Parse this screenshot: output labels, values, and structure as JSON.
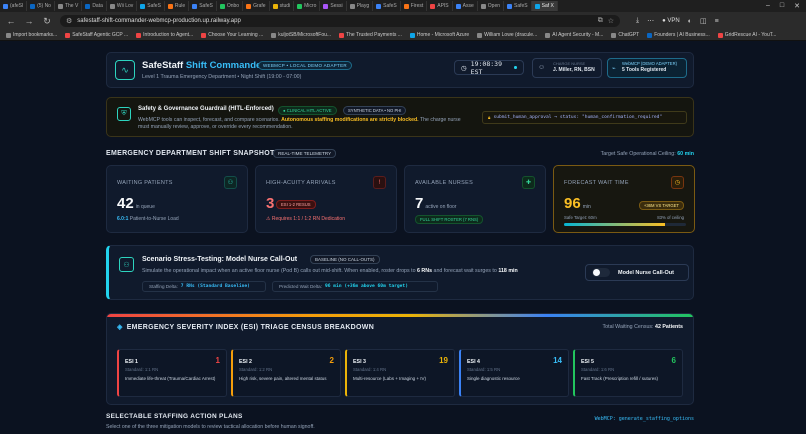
{
  "browser": {
    "tabs": [
      {
        "label": "(afeSl",
        "color": "#3b82f6"
      },
      {
        "label": "(5) No",
        "color": "#0a66c2"
      },
      {
        "label": "The V",
        "color": "#888888"
      },
      {
        "label": "Data",
        "color": "#0a66c2"
      },
      {
        "label": "Wii Lov",
        "color": "#888888"
      },
      {
        "label": "SafeS",
        "color": "#0ea5e9"
      },
      {
        "label": "Rule",
        "color": "#f97316"
      },
      {
        "label": "SafeS",
        "color": "#3b82f6"
      },
      {
        "label": "Onbo",
        "color": "#22c55e"
      },
      {
        "label": "Grafe",
        "color": "#f97316"
      },
      {
        "label": "studi",
        "color": "#eab308"
      },
      {
        "label": "Micro",
        "color": "#22c55e"
      },
      {
        "label": "Sessi",
        "color": "#a855f7"
      },
      {
        "label": "Playg",
        "color": "#888888"
      },
      {
        "label": "SafeS",
        "color": "#3b82f6"
      },
      {
        "label": "Firest",
        "color": "#f97316"
      },
      {
        "label": "APIS",
        "color": "#ef4444"
      },
      {
        "label": "Asse",
        "color": "#3b82f6"
      },
      {
        "label": "Open",
        "color": "#888888"
      },
      {
        "label": "SafeS",
        "color": "#3b82f6"
      },
      {
        "label": "Saf X",
        "color": "#0ea5e9",
        "active": true
      }
    ],
    "url": "safestaff-shift-commander-webmcp-production.up.railway.app",
    "vpn_label": "VPN",
    "bookmarks": [
      {
        "label": "Import bookmarks...",
        "color": "#888888"
      },
      {
        "label": "SafeStaff Agentic GCP ...",
        "color": "#ef4444"
      },
      {
        "label": "Introduction to Agent...",
        "color": "#ef4444"
      },
      {
        "label": "Choose Your Learning ...",
        "color": "#ef4444"
      },
      {
        "label": "kuljotSB/MicrosoftFou...",
        "color": "#888888"
      },
      {
        "label": "The Trusted Payments ...",
        "color": "#ef4444"
      },
      {
        "label": "Home - Microsoft Azure",
        "color": "#0ea5e9"
      },
      {
        "label": "William Lowe (dracule...",
        "color": "#888888"
      },
      {
        "label": "AI Agent Security - M...",
        "color": "#888888"
      },
      {
        "label": "ChatGPT",
        "color": "#888888"
      },
      {
        "label": "Founders | AI Business...",
        "color": "#0a66c2"
      },
      {
        "label": "GridRescue AI - YouT...",
        "color": "#ef4444"
      }
    ]
  },
  "header": {
    "title_main": "SafeStaff",
    "title_accent": "Shift Commander",
    "badge": "WEBMCP • LOCAL DEMO ADAPTER",
    "subtitle": "Level 1 Trauma Emergency Department  •  Night Shift (19:00 - 07:00)",
    "clock": "19:08:39 EST",
    "charge_nurse_label": "CHARGE NURSE",
    "charge_nurse": "J. Miller, RN, BSN",
    "tools_label": "WebMCP (DEMO ADAPTER)",
    "tools_value": "5 Tools Registered"
  },
  "guardrail": {
    "title": "Safety & Governance Guardrail (HITL-Enforced)",
    "pill_hitl": "CLINICAL HITL ACTIVE",
    "pill_synth": "SYNTHETIC DATA • NO PHI",
    "desc_a": "WebMCP tools can inspect, forecast, and compare scenarios.",
    "desc_bold": "Autonomous staffing modifications are strictly blocked.",
    "desc_b": "The charge nurse must manually review, approve, or override every recommendation.",
    "code": "submit_human_approval → status: \"human_confirmation_required\""
  },
  "snapshot": {
    "title": "EMERGENCY DEPARTMENT SHIFT SNAPSHOT",
    "badge": "REAL-TIME TELEMETRY",
    "ceiling_label": "Target Safe Operational Ceiling:",
    "ceiling_value": "60 min",
    "waiting": {
      "title": "WAITING PATIENTS",
      "value": "42",
      "unit": "in queue",
      "ratio": "6.0:1",
      "ratio_label": "Patient-to-Nurse Load"
    },
    "acuity": {
      "title": "HIGH-ACUITY ARRIVALS",
      "value": "3",
      "pill": "ESI 1-2 RESUS",
      "sub": "Requires 1:1 / 1:2 RN Dedication"
    },
    "nurses": {
      "title": "AVAILABLE NURSES",
      "value": "7",
      "unit": "active on floor",
      "pill": "FULL SHIFT ROSTER (7 RNS)"
    },
    "forecast": {
      "title": "FORECAST WAIT TIME",
      "value": "96",
      "unit": "min",
      "pill": "+36M VS TARGET",
      "safe": "Safe Target: 60m",
      "pct_label": "83% of ceiling",
      "fill": 0.83
    }
  },
  "scenario": {
    "title": "Scenario Stress-Testing: Model Nurse Call-Out",
    "badge": "BASELINE (NO CALL-OUTS)",
    "desc_a": "Simulate the operational impact when an active floor nurse (Pod B) calls out mid-shift. When enabled, roster drops to",
    "desc_b1": "6 RNs",
    "desc_c": "and forecast wait surges to",
    "desc_b2": "118 min",
    "staffing_label": "Staffing Delta:",
    "staffing_value": "7 RNs (Standard Baseline)",
    "wait_label": "Predicted Wait Delta:",
    "wait_value": "96 min (+36m above 60m target)",
    "toggle_label": "Model Nurse Call-Out"
  },
  "triage": {
    "title": "EMERGENCY SEVERITY INDEX (ESI) TRIAGE CENSUS BREAKDOWN",
    "total_label": "Total Waiting Census:",
    "total_value": "42 Patients",
    "levels": [
      {
        "label": "ESI 1",
        "count": "1",
        "standard": "Standard: 1:1 RN",
        "desc": "Immediate life-threat (Trauma/Cardiac Arrest)"
      },
      {
        "label": "ESI 2",
        "count": "2",
        "standard": "Standard: 1:2 RN",
        "desc": "High risk, severe pain, altered mental status"
      },
      {
        "label": "ESI 3",
        "count": "19",
        "standard": "Standard: 1:4 RN",
        "desc": "Multi-resource (Labs + Imaging + IV)"
      },
      {
        "label": "ESI 4",
        "count": "14",
        "standard": "Standard: 1:5 RN",
        "desc": "Single diagnostic resource"
      },
      {
        "label": "ESI 5",
        "count": "6",
        "standard": "Standard: 1:6 RN",
        "desc": "Fast Track (Prescription refill / sutures)"
      }
    ]
  },
  "plans": {
    "title": "SELECTABLE STAFFING ACTION PLANS",
    "subtitle": "Select one of the three mitigation models to review tactical allocation before human signoff.",
    "code": "WebMCP: generate_staffing_options"
  }
}
